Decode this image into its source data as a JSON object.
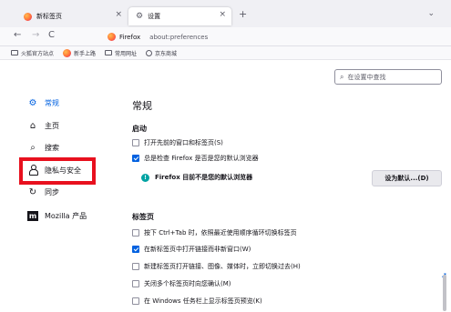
{
  "tabs": [
    {
      "title": "新标签页",
      "icon": "firefox-icon",
      "close": "×"
    },
    {
      "title": "设置",
      "icon": "gear-icon",
      "close": "×"
    }
  ],
  "new_tab_label": "+",
  "window_control": "⌄",
  "nav": {
    "back": "←",
    "forward": "→",
    "reload": "C",
    "brand": "Firefox",
    "url": "about:preferences"
  },
  "bookmarks": [
    {
      "label": "火狐官方站点",
      "icon": "folder-icon"
    },
    {
      "label": "新手上路",
      "icon": "firefox-icon"
    },
    {
      "label": "常用网址",
      "icon": "folder-icon"
    },
    {
      "label": "京东商城",
      "icon": "globe-icon"
    }
  ],
  "search": {
    "placeholder": "在设置中查找"
  },
  "sidebar": {
    "items": [
      {
        "label": "常规",
        "icon": "gear-icon",
        "active": true
      },
      {
        "label": "主页",
        "icon": "home-icon",
        "active": false
      },
      {
        "label": "搜索",
        "icon": "search-icon",
        "active": false
      },
      {
        "label": "隐私与安全",
        "icon": "lock-icon",
        "active": false
      },
      {
        "label": "同步",
        "icon": "sync-icon",
        "active": false
      },
      {
        "label": "Mozilla 产品",
        "icon": "mozilla-icon",
        "active": false
      }
    ],
    "highlight_color": "#e8101e"
  },
  "main": {
    "title": "常规",
    "startup": {
      "title": "启动",
      "options": [
        {
          "label": "打开先前的窗口和标签页(S)",
          "checked": false
        },
        {
          "label": "总是检查 Firefox 是否是您的默认浏览器",
          "checked": true
        }
      ],
      "default_status": "Firefox 目前不是您的默认浏览器",
      "default_button": "设为默认...(D)"
    },
    "tabs": {
      "title": "标签页",
      "options": [
        {
          "label": "按下 Ctrl+Tab 时，依照最近使用顺序循环切换标签页",
          "checked": false
        },
        {
          "label": "在新标签页中打开链接而非新窗口(W)",
          "checked": true
        },
        {
          "label": "新建标签页打开链接、图像、媒体时，立即切换过去(H)",
          "checked": false
        },
        {
          "label": "关闭多个标签页时向您确认(M)",
          "checked": false
        },
        {
          "label": "在 Windows 任务栏上显示标签页预览(K)",
          "checked": false
        }
      ]
    }
  },
  "colors": {
    "accent": "#0061e0",
    "highlight": "#e8101e"
  }
}
